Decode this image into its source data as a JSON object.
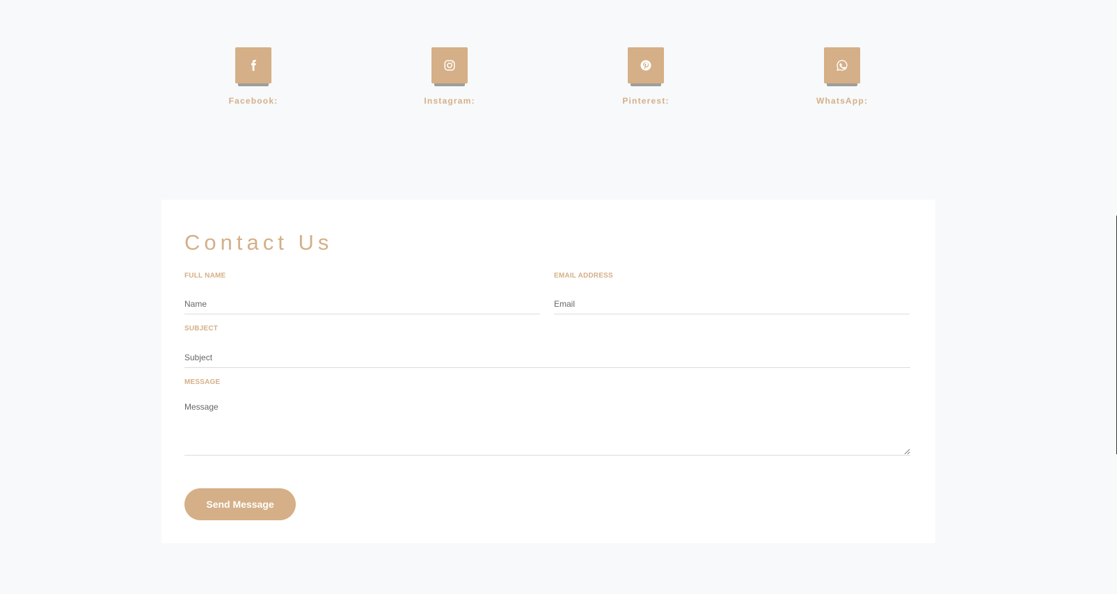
{
  "social": {
    "items": [
      {
        "label": "Facebook:",
        "icon": "facebook-icon"
      },
      {
        "label": "Instagram:",
        "icon": "instagram-icon"
      },
      {
        "label": "Pinterest:",
        "icon": "pinterest-icon"
      },
      {
        "label": "WhatsApp:",
        "icon": "whatsapp-icon"
      }
    ]
  },
  "contact": {
    "title": "Contact Us",
    "full_name": {
      "label": "FULL NAME",
      "placeholder": "Name",
      "value": ""
    },
    "email": {
      "label": "EMAIL ADDRESS",
      "placeholder": "Email",
      "value": ""
    },
    "subject": {
      "label": "SUBJECT",
      "placeholder": "Subject",
      "value": ""
    },
    "message": {
      "label": "MESSAGE",
      "placeholder": "Message",
      "value": ""
    },
    "send_label": "Send Message"
  },
  "colors": {
    "accent": "#d5af87",
    "page_background": "#f7f9fa",
    "card_background": "#ffffff",
    "icon_shadow": "#9d9d9d"
  }
}
